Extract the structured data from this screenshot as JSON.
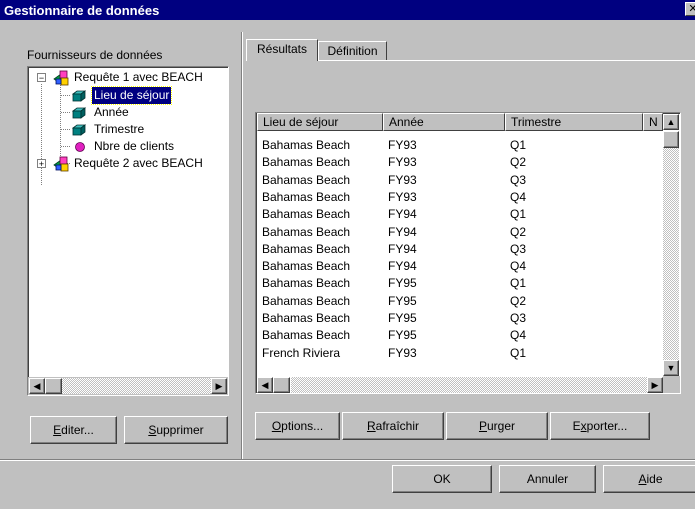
{
  "window": {
    "title": "Gestionnaire de données",
    "close_glyph": "✕"
  },
  "left_panel": {
    "label": "Fournisseurs de données",
    "tree": [
      {
        "label": "Requête 1 avec BEACH",
        "expander": "−",
        "icon": "query-cube-icon"
      },
      {
        "label": "Lieu de séjour",
        "icon": "dimension-icon",
        "selected": true
      },
      {
        "label": "Année",
        "icon": "dimension-icon"
      },
      {
        "label": "Trimestre",
        "icon": "dimension-icon"
      },
      {
        "label": "Nbre de clients",
        "icon": "measure-icon"
      },
      {
        "label": "Requête 2 avec BEACH",
        "expander": "+",
        "icon": "query-cube-icon"
      }
    ],
    "edit_label": "Editer...",
    "edit_mnemonic": "E",
    "delete_label": "Supprimer",
    "delete_mnemonic": "S"
  },
  "tabs": [
    {
      "label": "Résultats",
      "active": true
    },
    {
      "label": "Définition",
      "active": false
    }
  ],
  "results": {
    "columns": [
      "Lieu de séjour",
      "Année",
      "Trimestre",
      "N"
    ],
    "rows": [
      [
        "Bahamas Beach",
        "FY93",
        "Q1"
      ],
      [
        "Bahamas Beach",
        "FY93",
        "Q2"
      ],
      [
        "Bahamas Beach",
        "FY93",
        "Q3"
      ],
      [
        "Bahamas Beach",
        "FY93",
        "Q4"
      ],
      [
        "Bahamas Beach",
        "FY94",
        "Q1"
      ],
      [
        "Bahamas Beach",
        "FY94",
        "Q2"
      ],
      [
        "Bahamas Beach",
        "FY94",
        "Q3"
      ],
      [
        "Bahamas Beach",
        "FY94",
        "Q4"
      ],
      [
        "Bahamas Beach",
        "FY95",
        "Q1"
      ],
      [
        "Bahamas Beach",
        "FY95",
        "Q2"
      ],
      [
        "Bahamas Beach",
        "FY95",
        "Q3"
      ],
      [
        "Bahamas Beach",
        "FY95",
        "Q4"
      ],
      [
        "French Riviera",
        "FY93",
        "Q1"
      ]
    ]
  },
  "result_buttons": {
    "options": "Options...",
    "refresh": "Rafraîchir",
    "purge": "Purger",
    "export": "Exporter..."
  },
  "footer": {
    "ok": "OK",
    "cancel": "Annuler",
    "help": "Aide"
  },
  "colors": {
    "titlebar": "#000080",
    "face": "#c0c0c0",
    "selection": "#000080",
    "cube_green": "#00a040",
    "cube_pink": "#e040c0",
    "measure": "#e020c0",
    "dimension": "#008080"
  }
}
